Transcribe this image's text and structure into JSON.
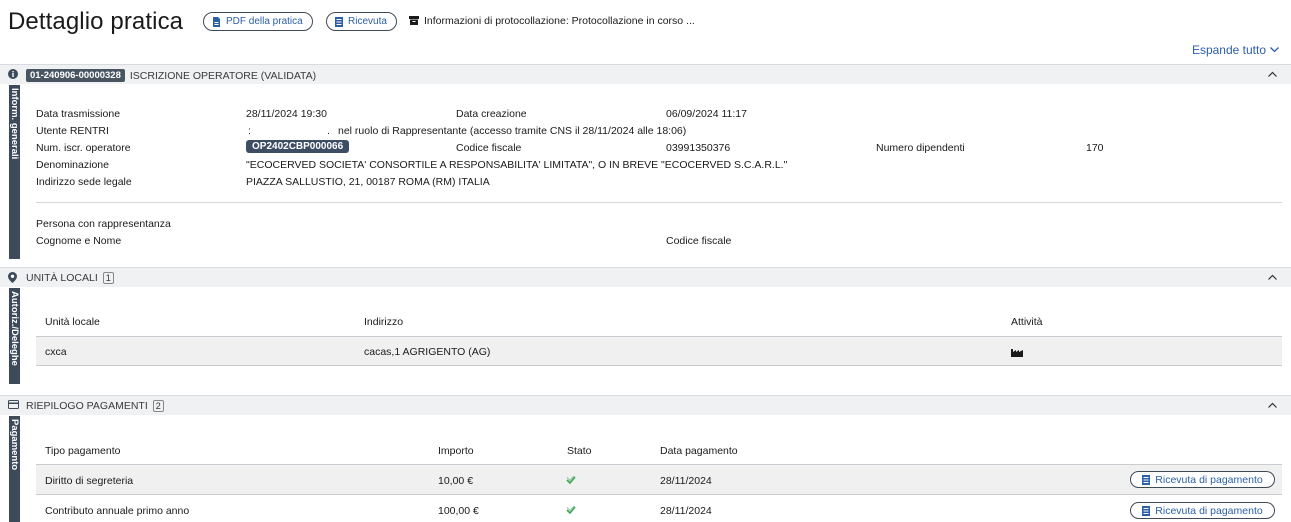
{
  "header": {
    "title": "Dettaglio pratica",
    "pdf_button": "PDF della pratica",
    "ricevuta_button": "Ricevuta",
    "protocol_text": "Informazioni di protocollazione: Protocollazione in corso ..."
  },
  "expand_all": "Espande tutto",
  "general": {
    "sidebar_label": "Inform. generali",
    "badge": "01-240906-00000328",
    "title": "ISCRIZIONE OPERATORE  (VALIDATA)",
    "labels": {
      "data_trasmissione": "Data trasmissione",
      "utente_rentri": "Utente RENTRI",
      "num_iscr": "Num. iscr. operatore",
      "denominazione": "Denominazione",
      "indirizzo": "Indirizzo sede legale",
      "data_creazione": "Data creazione",
      "codice_fiscale": "Codice fiscale",
      "numero_dipendenti": "Numero dipendenti"
    },
    "values": {
      "data_trasmissione": "28/11/2024 19:30",
      "utente_rentri_start": ":",
      "utente_rentri_dot": ".",
      "utente_rentri": "nel ruolo di Rappresentante (accesso tramite CNS il 28/11/2024 alle 18:06)",
      "num_iscr": "OP2402CBP000066",
      "denominazione": "\"ECOCERVED SOCIETA' CONSORTILE A RESPONSABILITA' LIMITATA\", O IN BREVE \"ECOCERVED S.C.A.R.L.\"",
      "indirizzo": "PIAZZA SALLUSTIO, 21, 00187 ROMA (RM) ITALIA",
      "data_creazione": "06/09/2024 11:17",
      "codice_fiscale": "03991350376",
      "numero_dipendenti": "170"
    },
    "rappresentanza": {
      "heading": "Persona con rappresentanza",
      "cognome_nome": "Cognome e Nome",
      "codice_fiscale": "Codice fiscale"
    }
  },
  "unita_locali": {
    "sidebar_label": "Autoriz./Deleghe",
    "title": "UNITÀ LOCALI",
    "count": "1",
    "columns": [
      "Unità locale",
      "Indirizzo",
      "Attività"
    ],
    "rows": [
      {
        "unita": "cxca",
        "indirizzo": "cacas,1 AGRIGENTO (AG)",
        "attivita_icon": "factory-icon"
      }
    ]
  },
  "pagamenti": {
    "sidebar_label": "Pagamento",
    "title": "RIEPILOGO PAGAMENTI",
    "count": "2",
    "columns": [
      "Tipo pagamento",
      "Importo",
      "Stato",
      "Data pagamento"
    ],
    "button_label": "Ricevuta di pagamento",
    "rows": [
      {
        "tipo": "Diritto di segreteria",
        "importo": "10,00 €",
        "stato_icon": "check-icon",
        "data": "28/11/2024"
      },
      {
        "tipo": "Contributo annuale primo anno",
        "importo": "100,00 €",
        "stato_icon": "check-icon",
        "data": "28/11/2024"
      }
    ]
  },
  "colors": {
    "link": "#2b5fa7",
    "sidebar": "#3c4a5a",
    "section_header": "#f0f1f2",
    "status_ok": "#3aa655"
  }
}
